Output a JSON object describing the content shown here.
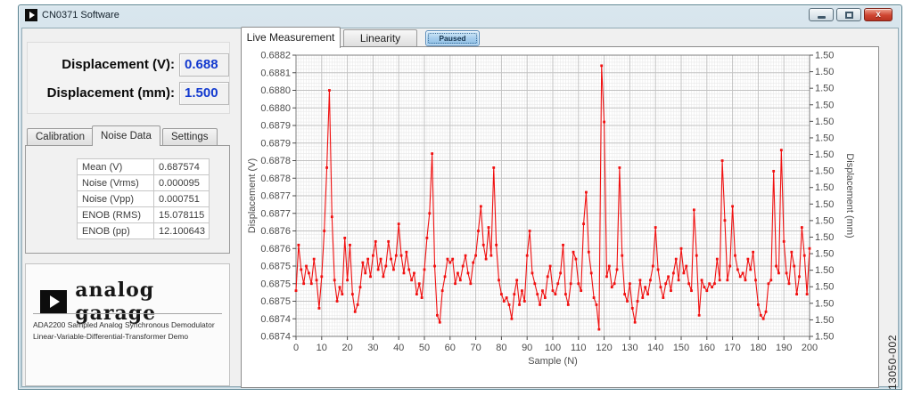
{
  "window": {
    "title": "CN0371 Software"
  },
  "left_panel": {
    "displacement_v_label": "Displacement (V):",
    "displacement_v_value": "0.688",
    "displacement_mm_label": "Displacement (mm):",
    "displacement_mm_value": "1.500",
    "tabs": {
      "0": "Calibration",
      "1": "Noise Data",
      "2": "Settings"
    },
    "active_tab": "Noise Data",
    "stats": [
      {
        "label": "Mean (V)",
        "value": "0.687574"
      },
      {
        "label": "Noise (Vrms)",
        "value": "0.000095"
      },
      {
        "label": "Noise (Vpp)",
        "value": "0.000751"
      },
      {
        "label": "ENOB (RMS)",
        "value": "15.078115"
      },
      {
        "label": "ENOB (pp)",
        "value": "12.100643"
      }
    ],
    "logo_text": "analog garage",
    "description_line1": "ADA2200 Sampled Analog Synchronous Demodulator",
    "description_line2": "Linear-Variable-Differential-Transformer Demo"
  },
  "right_panel": {
    "tabs": {
      "0": "Live Measurement",
      "1": "Linearity"
    },
    "active_tab": "Live Measurement",
    "paused_button_label": "Paused"
  },
  "figure_number": "13050-002",
  "colors": {
    "value_text_blue": "#1239cf",
    "close_button_red": "#cf4531",
    "paused_button_blue": "#a6cdec",
    "chart_line_red": "#f01010"
  },
  "chart_data": {
    "type": "line",
    "title": "",
    "xlabel": "Sample (N)",
    "ylabel_left": "Displacement (V)",
    "ylabel_right": "Displacement (mm)",
    "xlim": [
      0,
      200
    ],
    "ylim": [
      0.6874,
      0.6882
    ],
    "grid": true,
    "legend": "none",
    "line_color": "#f01010",
    "x_tick_labels": [
      "0",
      "10",
      "20",
      "30",
      "40",
      "50",
      "60",
      "70",
      "80",
      "90",
      "100",
      "110",
      "120",
      "130",
      "140",
      "150",
      "160",
      "170",
      "180",
      "190",
      "200"
    ],
    "y_tick_labels_left": [
      "0.6882",
      "0.6881",
      "0.6880",
      "0.6880",
      "0.6879",
      "0.6879",
      "0.6878",
      "0.6878",
      "0.6877",
      "0.6877",
      "0.6876",
      "0.6876",
      "0.6875",
      "0.6875",
      "0.6875",
      "0.6874",
      "0.6874"
    ],
    "y_tick_labels_right": [
      "1.50",
      "1.50",
      "1.50",
      "1.50",
      "1.50",
      "1.50",
      "1.50",
      "1.50",
      "1.50",
      "1.50",
      "1.50",
      "1.50",
      "1.50",
      "1.50",
      "1.50",
      "1.50",
      "1.50",
      "1.50"
    ],
    "x_start": 0,
    "x_step": 1,
    "values": [
      0.68753,
      0.68766,
      0.68759,
      0.68755,
      0.6876,
      0.68758,
      0.68755,
      0.68762,
      0.68756,
      0.68748,
      0.68757,
      0.6877,
      0.68788,
      0.6881,
      0.68774,
      0.68756,
      0.6875,
      0.68754,
      0.68752,
      0.68768,
      0.68756,
      0.68766,
      0.68752,
      0.68747,
      0.68749,
      0.68754,
      0.68761,
      0.68758,
      0.68762,
      0.68757,
      0.68763,
      0.68767,
      0.68759,
      0.68762,
      0.68757,
      0.6876,
      0.68767,
      0.68762,
      0.68759,
      0.68763,
      0.68772,
      0.68763,
      0.68758,
      0.68764,
      0.68759,
      0.68756,
      0.68758,
      0.68752,
      0.68755,
      0.68751,
      0.68759,
      0.68768,
      0.68775,
      0.68792,
      0.6876,
      0.68746,
      0.68744,
      0.68753,
      0.68757,
      0.68762,
      0.68761,
      0.68762,
      0.68755,
      0.68758,
      0.68756,
      0.6876,
      0.68763,
      0.68758,
      0.68755,
      0.68761,
      0.68763,
      0.6877,
      0.68777,
      0.68766,
      0.68762,
      0.68771,
      0.68763,
      0.68788,
      0.68766,
      0.68756,
      0.68752,
      0.6875,
      0.68751,
      0.68749,
      0.68745,
      0.68752,
      0.68756,
      0.68749,
      0.68753,
      0.6875,
      0.68763,
      0.6877,
      0.68758,
      0.68755,
      0.68752,
      0.68749,
      0.68753,
      0.68751,
      0.68757,
      0.6876,
      0.68753,
      0.68752,
      0.68755,
      0.68758,
      0.68766,
      0.68752,
      0.68749,
      0.68755,
      0.68764,
      0.68762,
      0.68755,
      0.68753,
      0.68772,
      0.68781,
      0.68764,
      0.68758,
      0.68751,
      0.68749,
      0.68742,
      0.68817,
      0.68801,
      0.68757,
      0.6876,
      0.68754,
      0.68755,
      0.68759,
      0.68788,
      0.68763,
      0.68752,
      0.6875,
      0.68755,
      0.68748,
      0.68744,
      0.6875,
      0.68756,
      0.68751,
      0.68754,
      0.68752,
      0.68756,
      0.6876,
      0.68771,
      0.68759,
      0.68754,
      0.68751,
      0.68755,
      0.68757,
      0.68753,
      0.68758,
      0.68762,
      0.68756,
      0.68765,
      0.68758,
      0.6876,
      0.68755,
      0.68753,
      0.68776,
      0.68763,
      0.68746,
      0.68756,
      0.68754,
      0.68753,
      0.68755,
      0.68754,
      0.68755,
      0.68762,
      0.68756,
      0.6879,
      0.68773,
      0.68756,
      0.6876,
      0.68777,
      0.68763,
      0.68759,
      0.68757,
      0.68758,
      0.68756,
      0.68762,
      0.68759,
      0.68764,
      0.68756,
      0.68749,
      0.68746,
      0.68745,
      0.68747,
      0.68755,
      0.68756,
      0.68787,
      0.6876,
      0.68758,
      0.68793,
      0.68767,
      0.68758,
      0.68755,
      0.68764,
      0.6876,
      0.68752,
      0.68757,
      0.68771,
      0.68763,
      0.68752,
      0.68765
    ]
  }
}
